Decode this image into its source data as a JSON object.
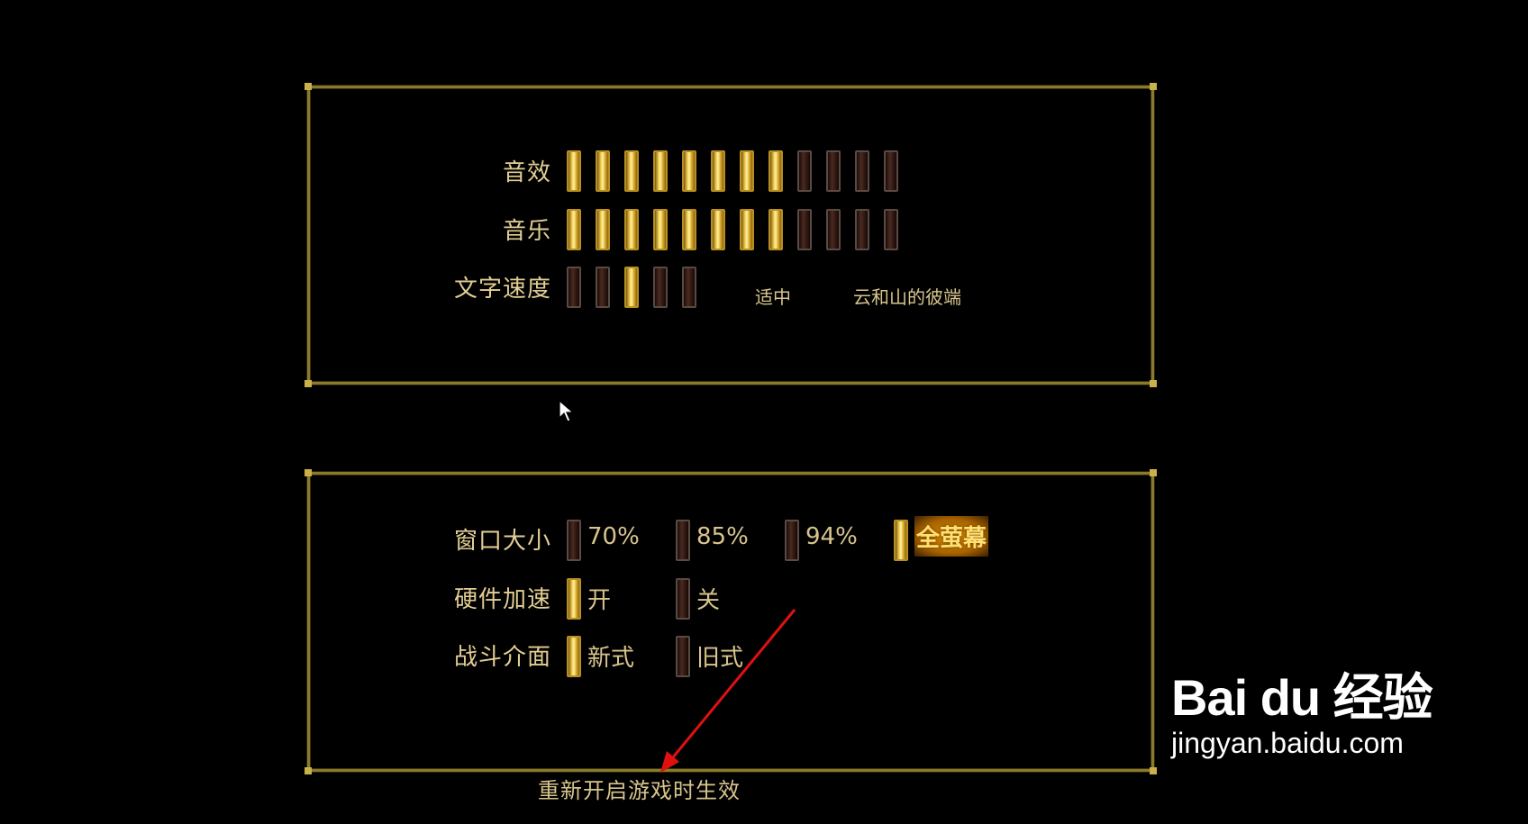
{
  "audio_panel": {
    "sound_effects": {
      "label": "音效",
      "level": 8,
      "max": 12
    },
    "music": {
      "label": "音乐",
      "level": 8,
      "max": 12
    },
    "text_speed": {
      "label": "文字速度",
      "level": 3,
      "max": 5,
      "value_label": "适中",
      "preview_text": "云和山的彼端"
    }
  },
  "display_panel": {
    "window_size": {
      "label": "窗口大小",
      "options": [
        "70%",
        "85%",
        "94%",
        "全萤幕"
      ],
      "selected": "全萤幕"
    },
    "hardware_accel": {
      "label": "硬件加速",
      "options": [
        "开",
        "关"
      ],
      "selected": "开"
    },
    "battle_ui": {
      "label": "战斗介面",
      "options": [
        "新式",
        "旧式"
      ],
      "selected": "新式"
    }
  },
  "footer_note": "重新开启游戏时生效",
  "watermark": {
    "logo": "Bai du 经验",
    "url": "jingyan.baidu.com"
  },
  "colors": {
    "frame": "#8a7a2c",
    "bar_on": "#f4d35a",
    "bar_off": "#4a2a20",
    "arrow": "#e01010"
  }
}
